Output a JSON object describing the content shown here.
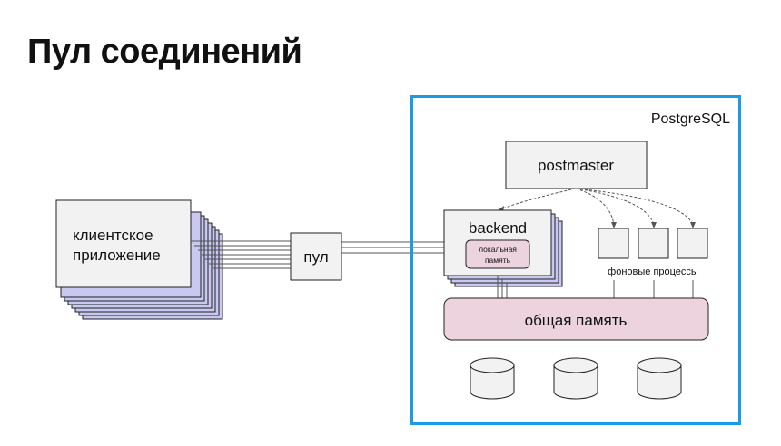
{
  "title": "Пул соединений",
  "client": {
    "label_line1": "клиентское",
    "label_line2": "приложение"
  },
  "pool": {
    "label": "пул"
  },
  "postgres": {
    "label": "PostgreSQL",
    "postmaster": "postmaster",
    "backend": "backend",
    "local_memory_line1": "локальная",
    "local_memory_line2": "память",
    "background_processes": "фоновые процессы",
    "shared_memory": "общая память"
  },
  "colors": {
    "postgres_border": "#1a9be6",
    "stack_fill": "#c8c8f0",
    "box_fill": "#f2f2f2",
    "memory_fill": "#ecd3dd"
  }
}
